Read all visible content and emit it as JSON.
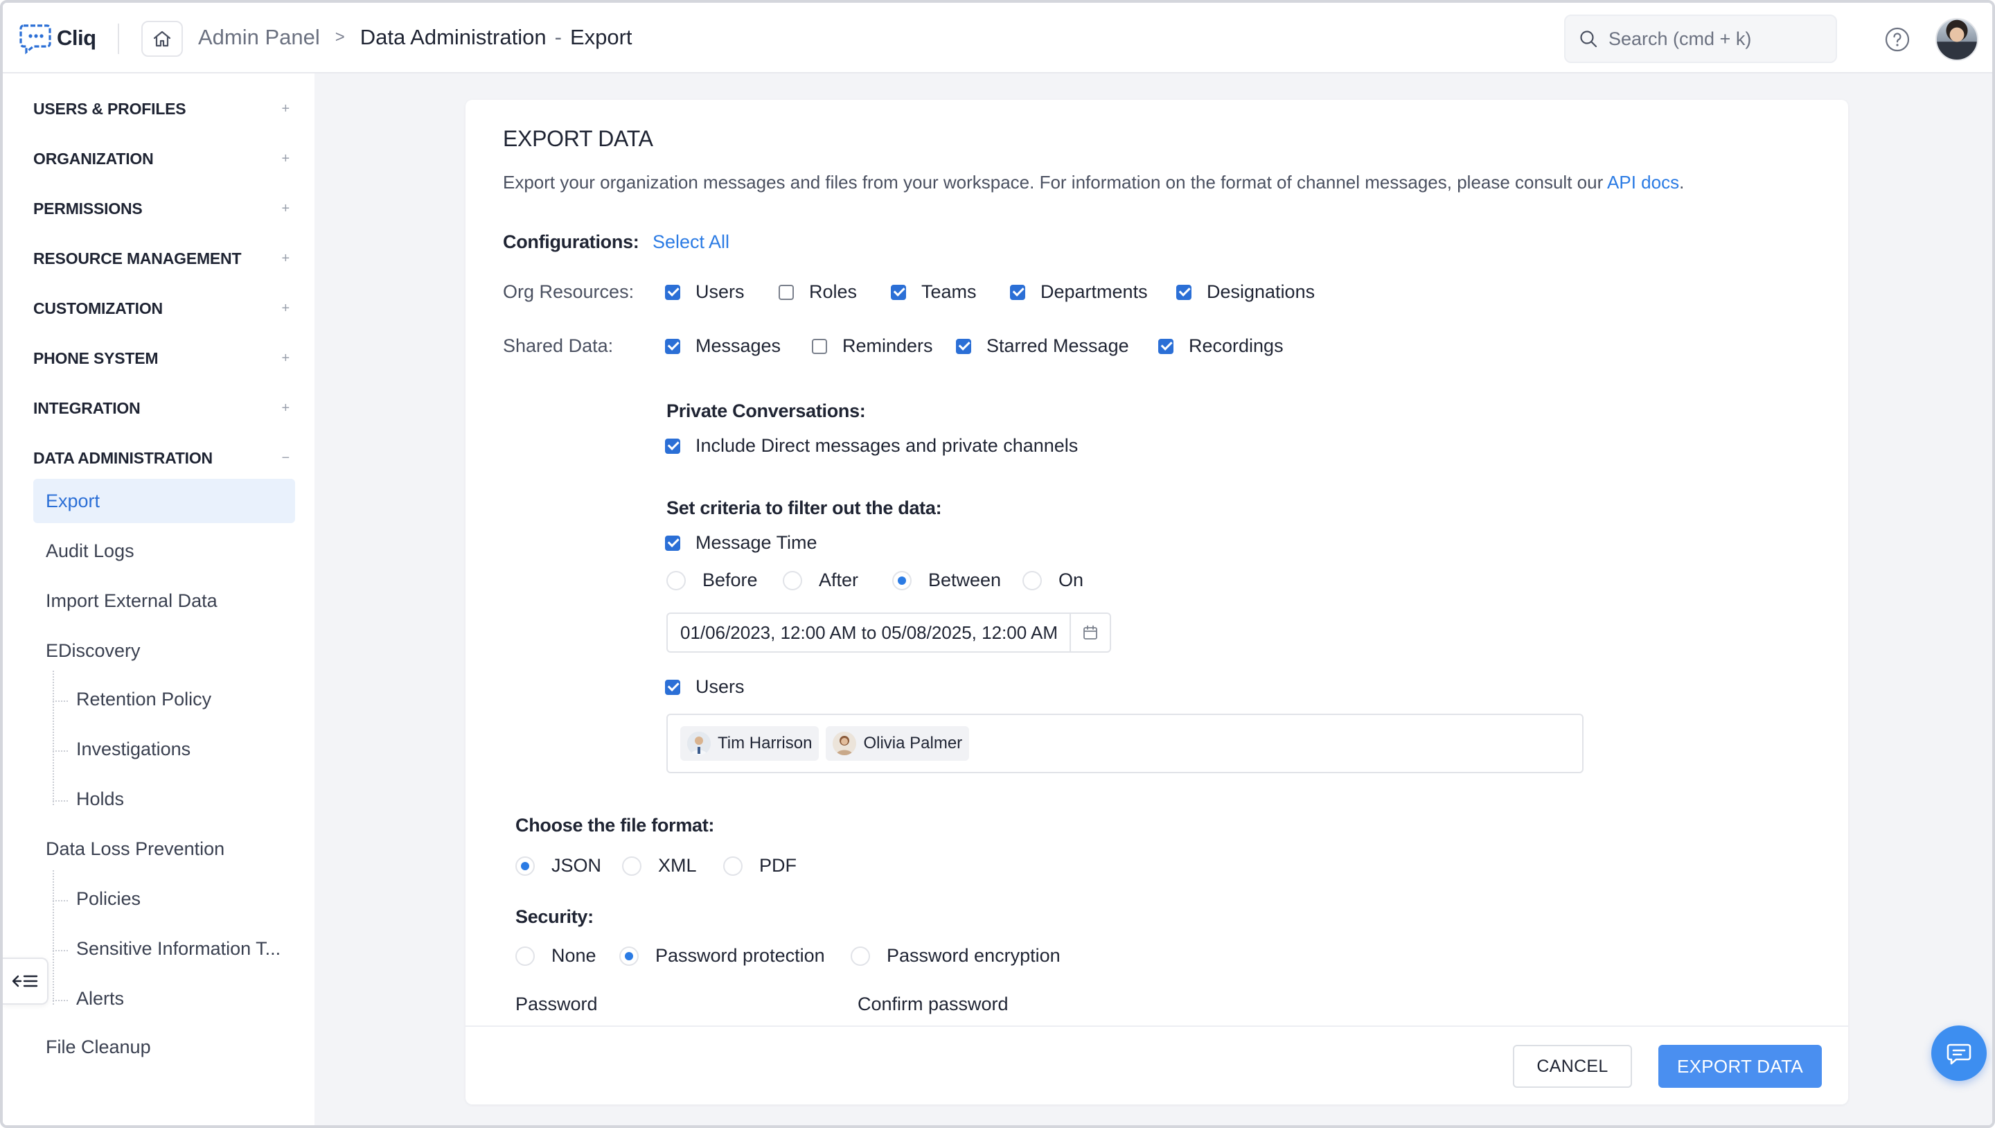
{
  "app": {
    "name": "Cliq"
  },
  "breadcrumb": {
    "root": "Admin Panel",
    "separator": ">",
    "section": "Data Administration",
    "dash": "-",
    "page": "Export"
  },
  "search": {
    "placeholder": "Search (cmd + k)"
  },
  "sidebar": {
    "sections": [
      {
        "label": "USERS & PROFILES",
        "toggle": "+"
      },
      {
        "label": "ORGANIZATION",
        "toggle": "+"
      },
      {
        "label": "PERMISSIONS",
        "toggle": "+"
      },
      {
        "label": "RESOURCE MANAGEMENT",
        "toggle": "+"
      },
      {
        "label": "CUSTOMIZATION",
        "toggle": "+"
      },
      {
        "label": "PHONE SYSTEM",
        "toggle": "+"
      },
      {
        "label": "INTEGRATION",
        "toggle": "+"
      },
      {
        "label": "DATA ADMINISTRATION",
        "toggle": "−"
      }
    ],
    "items": [
      {
        "label": "Export"
      },
      {
        "label": "Audit Logs"
      },
      {
        "label": "Import External Data"
      },
      {
        "label": "EDiscovery"
      },
      {
        "label": "Retention Policy"
      },
      {
        "label": "Investigations"
      },
      {
        "label": "Holds"
      },
      {
        "label": "Data Loss Prevention"
      },
      {
        "label": "Policies"
      },
      {
        "label": "Sensitive Information T..."
      },
      {
        "label": "Alerts"
      },
      {
        "label": "File Cleanup"
      }
    ]
  },
  "export": {
    "title": "EXPORT DATA",
    "description": "Export your organization messages and files from your workspace. For information on the format of channel messages, please consult our ",
    "api_link": "API docs",
    "description_end": ".",
    "configurations_label": "Configurations:",
    "select_all": "Select All",
    "org_resources_label": "Org Resources:",
    "org_resources": [
      {
        "label": "Users",
        "checked": true
      },
      {
        "label": "Roles",
        "checked": false
      },
      {
        "label": "Teams",
        "checked": true
      },
      {
        "label": "Departments",
        "checked": true
      },
      {
        "label": "Designations",
        "checked": true
      }
    ],
    "shared_data_label": "Shared Data:",
    "shared_data": [
      {
        "label": "Messages",
        "checked": true
      },
      {
        "label": "Reminders",
        "checked": false
      },
      {
        "label": "Starred Message",
        "checked": true
      },
      {
        "label": "Recordings",
        "checked": true
      }
    ],
    "private_label": "Private Conversations:",
    "private_option": "Include Direct messages and private channels",
    "criteria_label": "Set criteria to filter out the data:",
    "message_time_label": "Message Time",
    "time_options": [
      {
        "label": "Before",
        "selected": false
      },
      {
        "label": "After",
        "selected": false
      },
      {
        "label": "Between",
        "selected": true
      },
      {
        "label": "On",
        "selected": false
      }
    ],
    "date_range": "01/06/2023, 12:00 AM to 05/08/2025, 12:00 AM",
    "users_label": "Users",
    "selected_users": [
      {
        "name": "Tim Harrison"
      },
      {
        "name": "Olivia Palmer"
      }
    ],
    "format_label": "Choose the file format:",
    "formats": [
      {
        "label": "JSON",
        "selected": true
      },
      {
        "label": "XML",
        "selected": false
      },
      {
        "label": "PDF",
        "selected": false
      }
    ],
    "security_label": "Security:",
    "security_options": [
      {
        "label": "None",
        "selected": false
      },
      {
        "label": "Password protection",
        "selected": true
      },
      {
        "label": "Password encryption",
        "selected": false
      }
    ],
    "password_label": "Password",
    "confirm_password_label": "Confirm password",
    "cancel_label": "CANCEL",
    "export_label": "EXPORT DATA"
  },
  "colors": {
    "accent": "#2b6fd6",
    "link": "#2b7be4",
    "primary_button": "#4a8ff0",
    "background": "#f3f4f7"
  }
}
